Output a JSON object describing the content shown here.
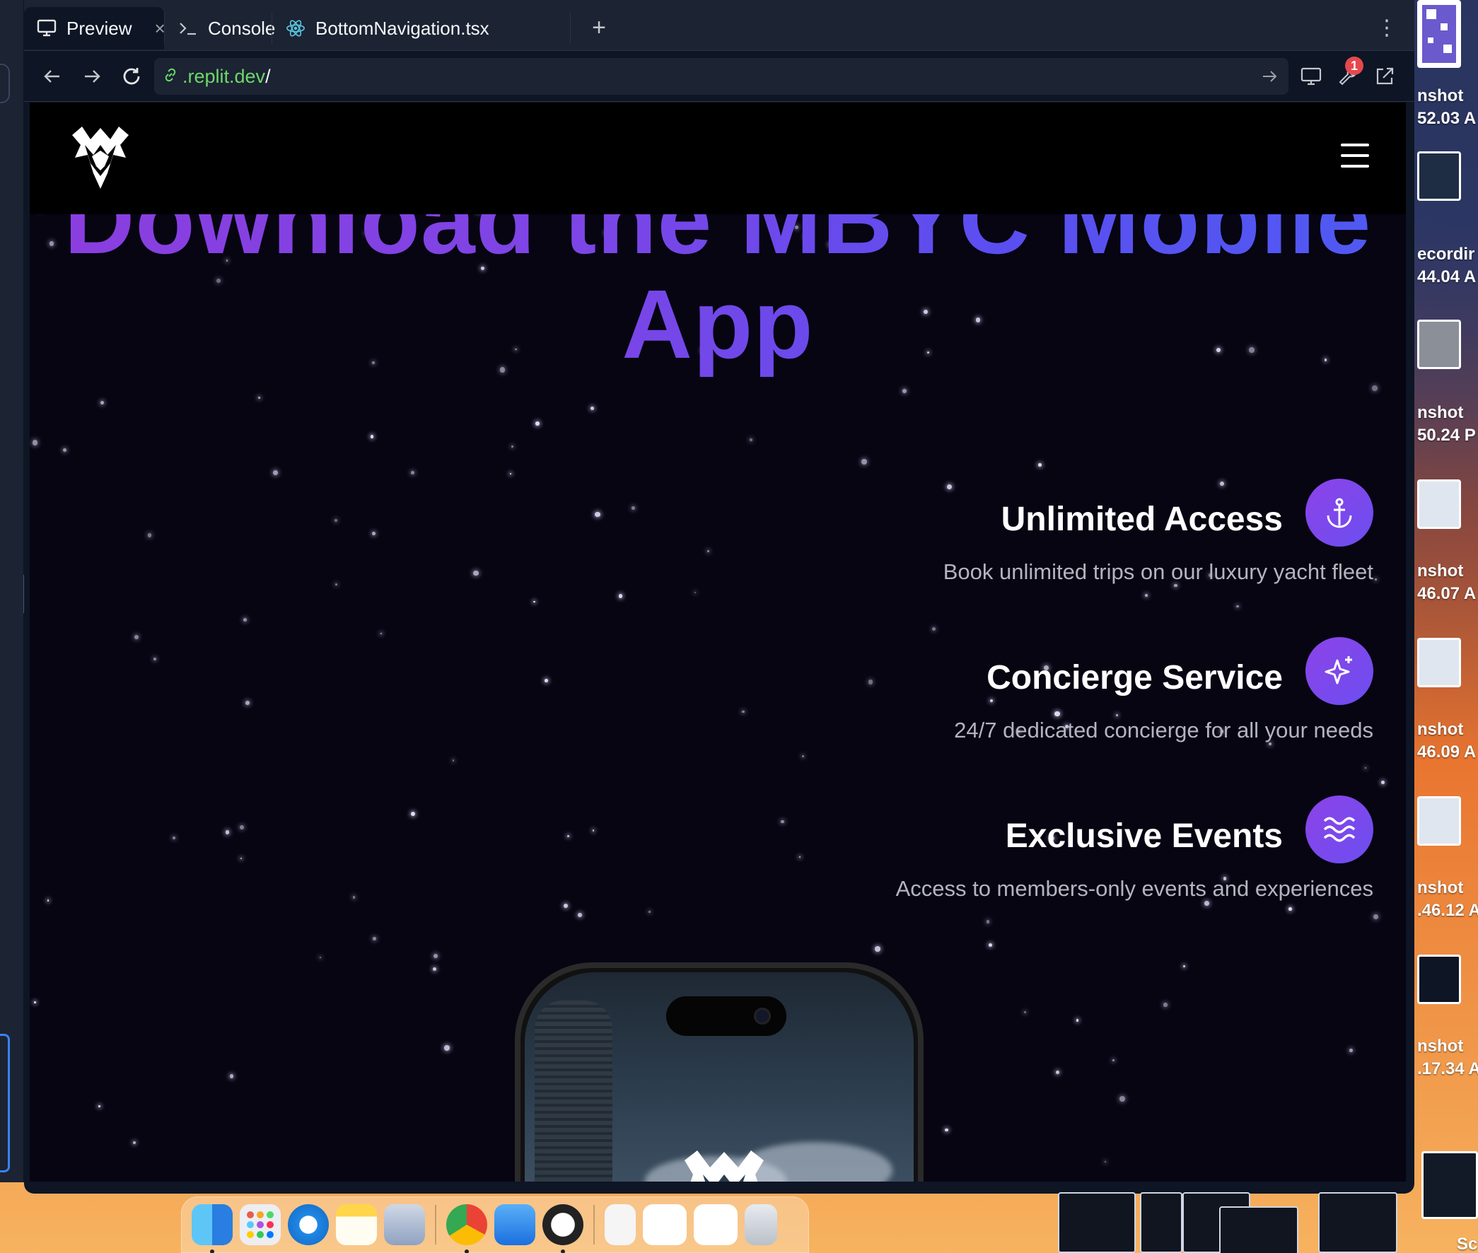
{
  "browser": {
    "tabs": [
      {
        "label": "Preview",
        "icon": "monitor-icon",
        "active": true
      },
      {
        "label": "Console",
        "icon": "terminal-icon",
        "active": false
      },
      {
        "label": "BottomNavigation.tsx",
        "icon": "react-icon",
        "active": false
      }
    ],
    "new_tab_symbol": "+",
    "more_symbol": "⋮",
    "url_domain": ".replit.dev",
    "url_path": "/",
    "devtools_badge": "1"
  },
  "site": {
    "hero_title": "Download the MBYC Mobile App",
    "features": [
      {
        "title": "Unlimited Access",
        "description": "Book unlimited trips on our luxury yacht fleet",
        "icon": "anchor-icon"
      },
      {
        "title": "Concierge Service",
        "description": "24/7 dedicated concierge for all your needs",
        "icon": "sparkles-icon"
      },
      {
        "title": "Exclusive Events",
        "description": "Access to members-only events and experiences",
        "icon": "waves-icon"
      }
    ]
  },
  "desktop": {
    "file_labels": [
      {
        "line1": "nshot",
        "line2": "52.03 A"
      },
      {
        "line1": "ecordir",
        "line2": "44.04 A"
      },
      {
        "line1": "nshot",
        "line2": "50.24 P"
      },
      {
        "line1": "nshot",
        "line2": "46.07 A"
      },
      {
        "line1": "nshot",
        "line2": "46.09 A"
      },
      {
        "line1": "nshot",
        "line2": ".46.12 A"
      },
      {
        "line1": "nshot",
        "line2": ".17.34 A"
      }
    ],
    "corner_label": "Sc"
  },
  "dock": {
    "apps": [
      "finder-icon",
      "launchpad-icon",
      "safari-icon",
      "notes-icon",
      "preview-icon",
      "chrome-icon",
      "mail-icon",
      "instruments-icon",
      "document-icon",
      "chrome-window-icon",
      "chrome-window-icon",
      "trash-icon"
    ]
  },
  "colors": {
    "accent_purple": "#8b3ddf",
    "accent_indigo": "#4f5af2",
    "site_background": "#070512",
    "replit_link_green": "#6bd968"
  }
}
